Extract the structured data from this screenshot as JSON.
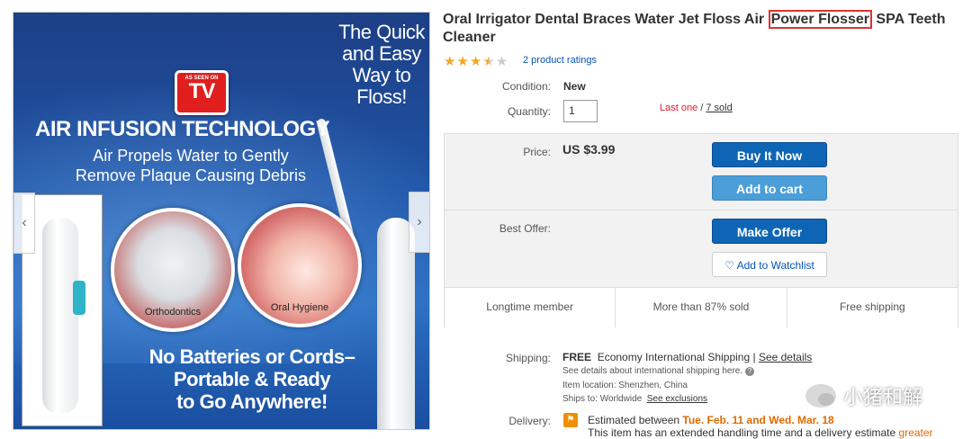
{
  "image": {
    "tagline": [
      "The Quick",
      "and Easy",
      "Way to",
      "Floss!"
    ],
    "badge_top": "AS SEEN ON",
    "badge_main": "TV",
    "headline": "AIR  INFUSION TECHNOLOGY",
    "subheadline": [
      "Air Propels Water  to Gently",
      "Remove Plaque Causing Debris"
    ],
    "circle_labels": [
      "Orthodontics",
      "Oral Hygiene"
    ],
    "bottom_text": [
      "No Batteries or Cords–",
      "Portable & Ready",
      "to Go Anywhere!"
    ],
    "prev_icon": "chevron-left-icon",
    "next_icon": "chevron-right-icon"
  },
  "product": {
    "title_before": "Oral Irrigator Dental Braces Water Jet Floss Air ",
    "title_highlight": "Power Flosser",
    "title_after": " SPA Teeth Cleaner",
    "rating": 3.5,
    "rating_max": 5,
    "ratings_link": "2 product ratings"
  },
  "details": {
    "condition_label": "Condition:",
    "condition_value": "New",
    "quantity_label": "Quantity:",
    "quantity_value": "1",
    "stock_text": "Last one",
    "stock_sep": " / ",
    "sold_text": "7 sold",
    "price_label": "Price:",
    "price_value": "US $3.99",
    "best_offer_label": "Best Offer:"
  },
  "buttons": {
    "buy_now": "Buy It Now",
    "add_to_cart": "Add to cart",
    "make_offer": "Make Offer",
    "watchlist": "Add to Watchlist",
    "watchlist_icon": "heart-outline-icon"
  },
  "features": [
    "Longtime member",
    "More than 87% sold",
    "Free shipping"
  ],
  "shipping": {
    "label": "Shipping:",
    "free": "FREE",
    "service": "Economy International Shipping",
    "pipe": " | ",
    "details_link": "See details",
    "intl_note": "See details about international shipping here.",
    "location": "Item location:  Shenzhen, China",
    "ships_to": "Ships to:  Worldwide",
    "exclusions_link": "See exclusions"
  },
  "delivery": {
    "label": "Delivery:",
    "estimated_prefix": "Estimated between ",
    "estimated_dates": "Tue. Feb. 11 and Wed. Mar. 18",
    "note_prefix": "This item has an extended handling time and a delivery estimate ",
    "note_emphasis": "greater"
  },
  "watermark": {
    "text": "小猪和解"
  },
  "colors": {
    "primary_button": "#0f65b5",
    "cart_button": "#4c9ed9",
    "link": "#0654ba",
    "alert_red": "#dd1e31",
    "star": "#f5a623",
    "highlight_box": "#e03131"
  }
}
